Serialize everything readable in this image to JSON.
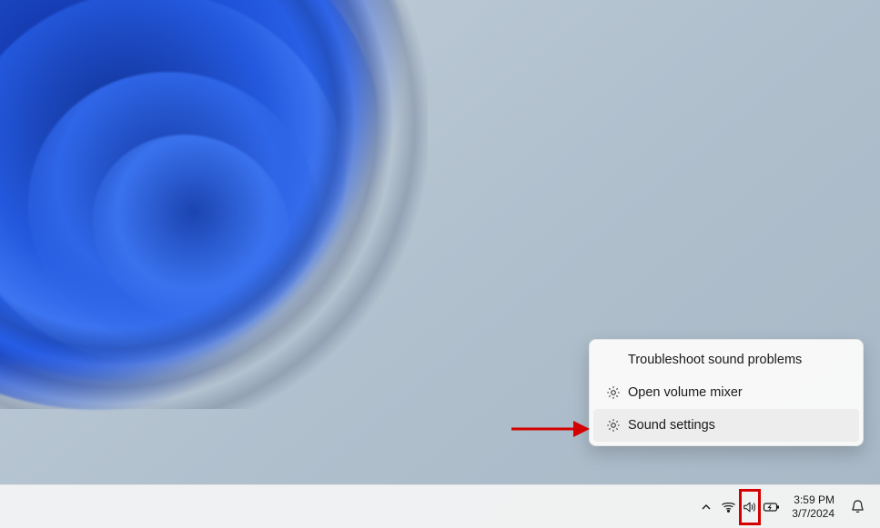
{
  "context_menu": {
    "items": [
      {
        "label": "Troubleshoot sound problems",
        "has_icon": false,
        "hovered": false
      },
      {
        "label": "Open volume mixer",
        "has_icon": true,
        "hovered": false
      },
      {
        "label": "Sound settings",
        "has_icon": true,
        "hovered": true
      }
    ]
  },
  "taskbar": {
    "time": "3:59 PM",
    "date": "3/7/2024"
  },
  "annotations": {
    "highlight_color": "#d40000",
    "arrow_color": "#d40000"
  }
}
